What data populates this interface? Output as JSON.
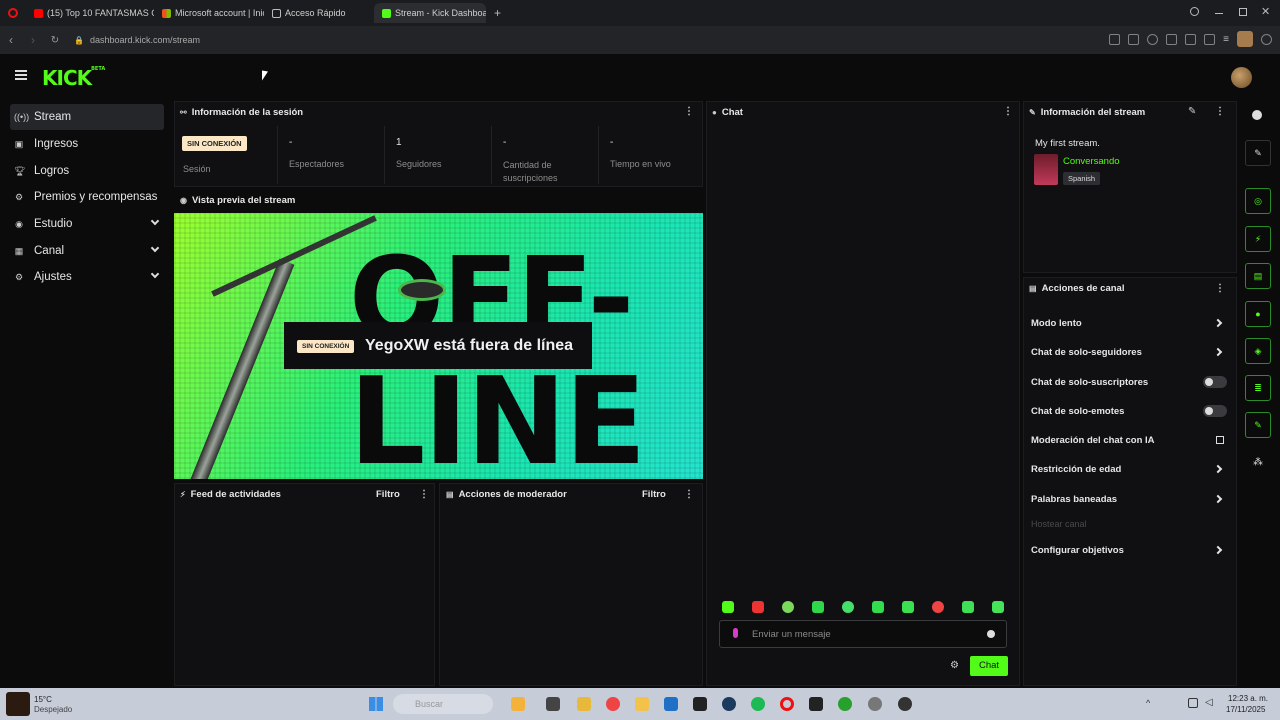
{
  "browser": {
    "tabs": [
      {
        "label": "(15) Top 10 FANTASMAS C"
      },
      {
        "label": "Microsoft account | Inicio"
      },
      {
        "label": "Acceso Rápido"
      },
      {
        "label": "Stream - Kick Dashboard"
      }
    ],
    "url": "dashboard.kick.com/stream"
  },
  "header": {
    "logo": "KICK",
    "logo_tag": "BETA"
  },
  "sidebar": {
    "items": [
      {
        "label": "Stream",
        "icon": "stream-icon"
      },
      {
        "label": "Ingresos",
        "icon": "income-icon"
      },
      {
        "label": "Logros",
        "icon": "trophy-icon"
      },
      {
        "label": "Premios y recompensas",
        "icon": "rewards-icon"
      },
      {
        "label": "Estudio",
        "icon": "studio-icon"
      },
      {
        "label": "Canal",
        "icon": "channel-icon"
      },
      {
        "label": "Ajustes",
        "icon": "settings-icon"
      }
    ]
  },
  "session": {
    "title": "Información de la sesión",
    "badge": "SIN CONEXIÓN",
    "session_label": "Sesión",
    "viewers_value": "-",
    "viewers_label": "Espectadores",
    "followers_value": "1",
    "followers_label": "Seguidores",
    "subs_value": "-",
    "subs_label": "Cantidad de suscripciones",
    "live_value": "-",
    "live_label": "Tiempo en vivo"
  },
  "preview": {
    "title": "Vista previa del stream",
    "badge": "SIN CONEXIÓN",
    "message": "YegoXW está fuera de línea",
    "line1": "OFF-",
    "line2": "LINE"
  },
  "feed": {
    "title": "Feed de actividades",
    "filter": "Filtro"
  },
  "modactions": {
    "title": "Acciones de moderador",
    "filter": "Filtro"
  },
  "chat": {
    "title": "Chat",
    "placeholder": "Enviar un mensaje",
    "send": "Chat"
  },
  "stream_info": {
    "title": "Información del stream",
    "stream_title": "My first stream.",
    "category": "Conversando",
    "language": "Spanish"
  },
  "channel_actions": {
    "title": "Acciones de canal",
    "items": [
      {
        "label": "Modo lento"
      },
      {
        "label": "Chat de solo-seguidores"
      },
      {
        "label": "Chat de solo-suscriptores"
      },
      {
        "label": "Chat de solo-emotes"
      },
      {
        "label": "Moderación del chat con IA"
      },
      {
        "label": "Restricción de edad"
      },
      {
        "label": "Palabras baneadas"
      },
      {
        "label": "Hostear canal"
      },
      {
        "label": "Configurar objetivos"
      }
    ]
  },
  "taskbar": {
    "weather_temp": "15°C",
    "weather_desc": "Despejado",
    "search": "Buscar",
    "time": "12:23 a. m.",
    "date": "17/11/2025"
  },
  "colors": {
    "accent": "#53fc18",
    "background": "#0b0b0c",
    "panel": "#101012"
  }
}
